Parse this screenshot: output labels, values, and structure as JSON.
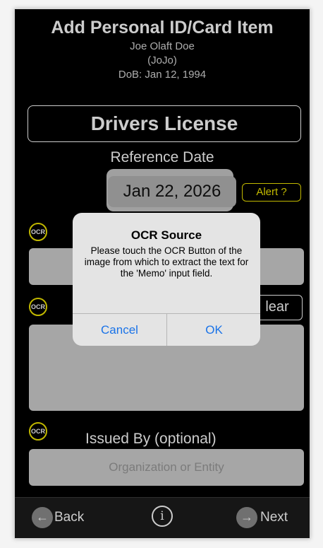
{
  "header": {
    "title": "Add Personal ID/Card Item",
    "name": "Joe Olaft Doe",
    "nickname": "(JoJo)",
    "dob": "DoB: Jan 12, 1994"
  },
  "document_type": "Drivers License",
  "reference": {
    "label": "Reference Date",
    "date": "Jan 22, 2026",
    "alert_label": "Alert ?"
  },
  "ocr_label": "OCR",
  "clear_label": "lear",
  "issued": {
    "label": "Issued By (optional)",
    "placeholder": "Organization or Entity"
  },
  "nav": {
    "back_label": "Back",
    "next_label": "Next",
    "back_icon": "←",
    "next_icon": "→",
    "info_icon": "i"
  },
  "dialog": {
    "title": "OCR Source",
    "message": "Please touch the OCR Button of the image from which to extract the text for the 'Memo' input field.",
    "cancel_label": "Cancel",
    "ok_label": "OK"
  },
  "colors": {
    "accent_yellow": "#f2e600",
    "dialog_button_blue": "#1a73e8",
    "background": "#000000"
  }
}
